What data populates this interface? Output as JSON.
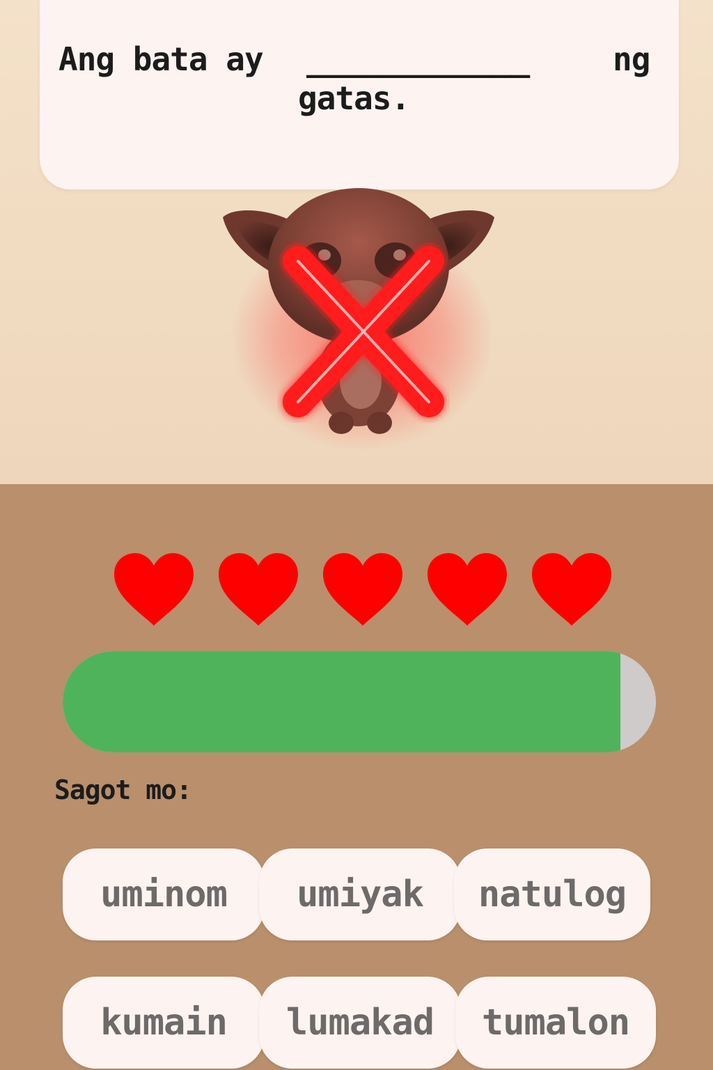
{
  "question": {
    "before": "Ang bata ay",
    "blank": "____________",
    "after": "ng",
    "continuation": "gatas."
  },
  "mascot": {
    "icon": "cat-mascot-icon"
  },
  "feedback": {
    "icon": "wrong-x-icon",
    "color": "#ff2020"
  },
  "lives": {
    "count": 5,
    "icon": "heart-icon",
    "color": "#ff0000"
  },
  "progress": {
    "fraction": 0.94,
    "fill_color": "#4fb35c",
    "track_color": "#cfcbcb"
  },
  "answer": {
    "label": "Sagot mo:"
  },
  "choices": [
    {
      "label": "uminom"
    },
    {
      "label": "umiyak"
    },
    {
      "label": "natulog"
    },
    {
      "label": "kumain"
    },
    {
      "label": "lumakad"
    },
    {
      "label": "tumalon"
    }
  ]
}
